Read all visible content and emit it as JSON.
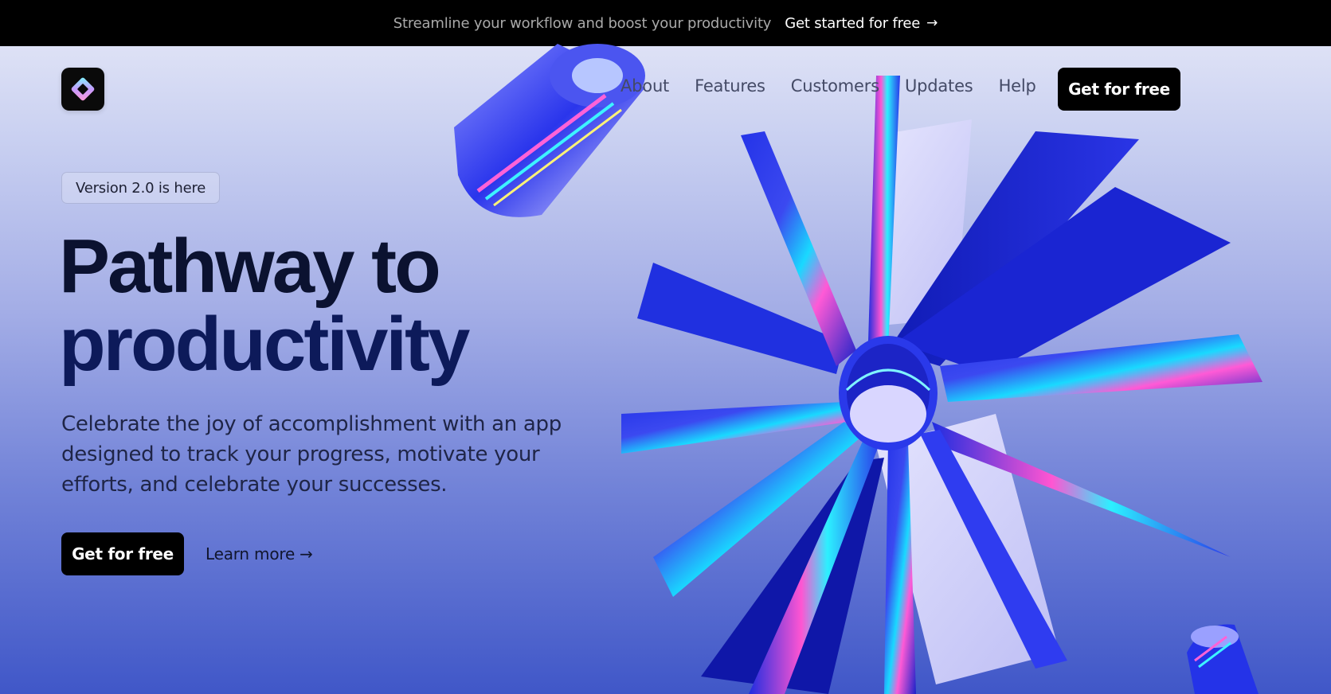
{
  "announcement": {
    "message": "Streamline your workflow and boost your productivity",
    "cta_label": "Get started for free",
    "cta_arrow": "→"
  },
  "header": {
    "logo_icon": "diamond-logo-icon",
    "nav": [
      {
        "label": "About"
      },
      {
        "label": "Features"
      },
      {
        "label": "Customers"
      },
      {
        "label": "Updates"
      },
      {
        "label": "Help"
      }
    ],
    "cta_label": "Get for free"
  },
  "hero": {
    "badge": "Version 2.0 is here",
    "headline_line1": "Pathway to",
    "headline_line2": "productivity",
    "subtext": "Celebrate the joy of accomplishment with an app designed to track your progress, motivate your efforts, and celebrate your successes.",
    "primary_label": "Get for free",
    "secondary_label": "Learn more",
    "secondary_arrow": "→"
  },
  "colors": {
    "bar_bg": "#000000",
    "accent_blue": "#1f2fe0",
    "cyan": "#19e3ff",
    "magenta": "#ff4fd8",
    "headline": "#0b1230"
  }
}
